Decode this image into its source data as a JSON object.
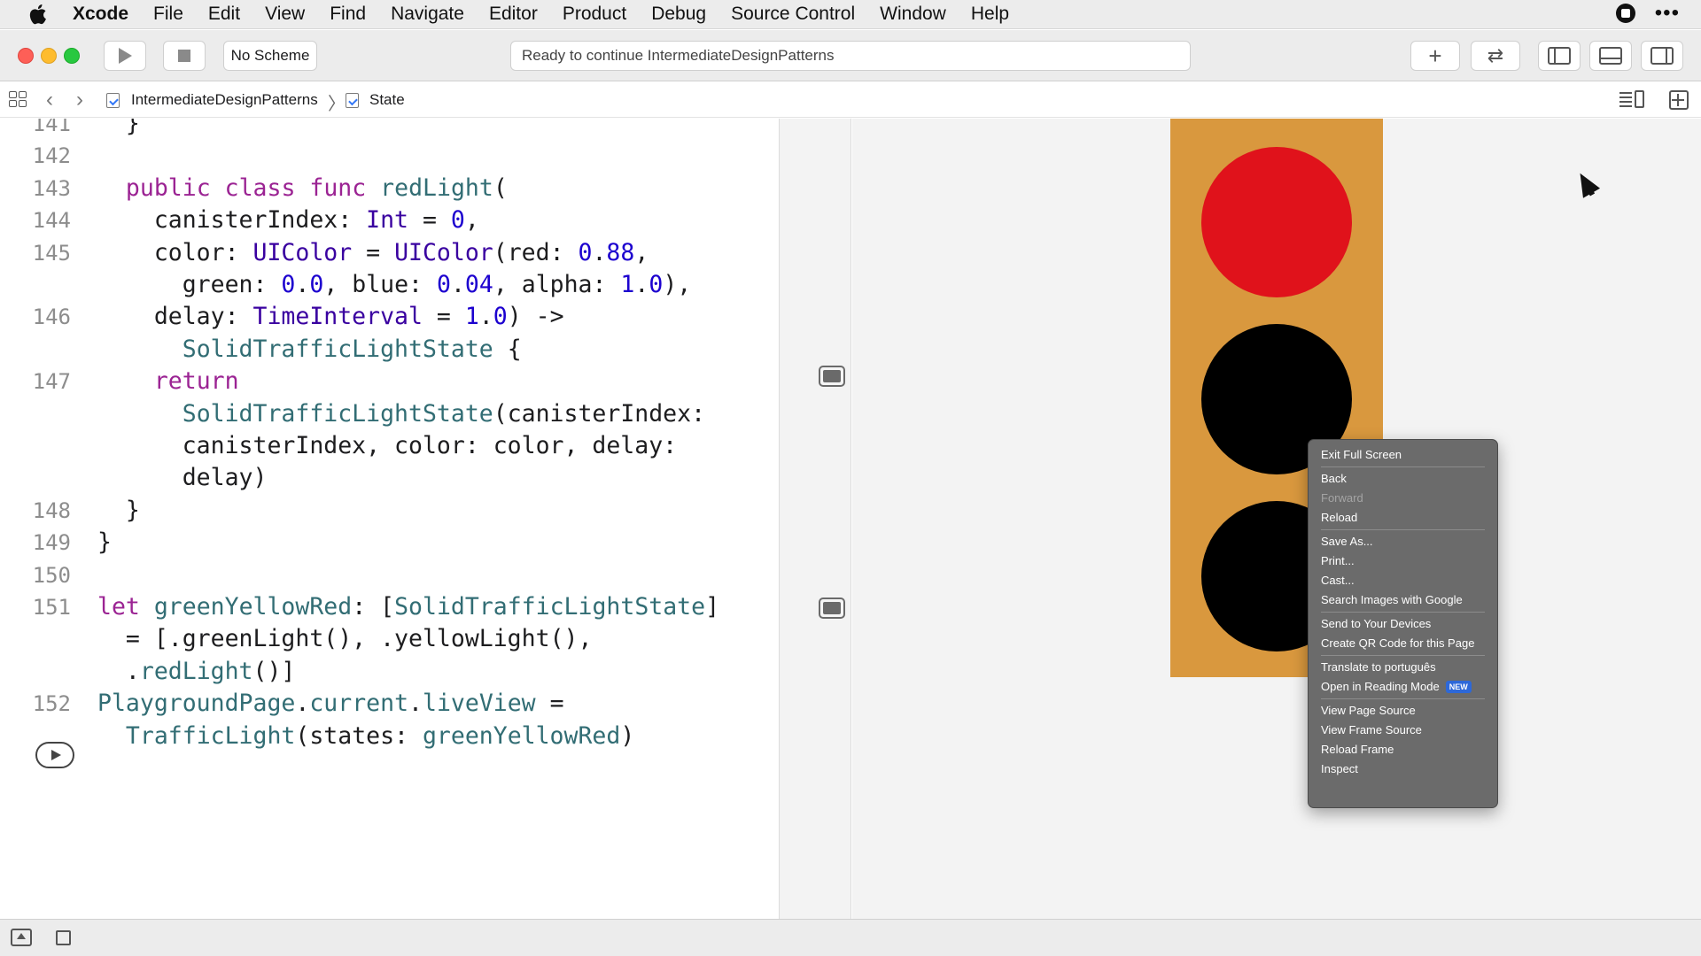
{
  "menubar": {
    "app_name": "Xcode",
    "items": [
      "File",
      "Edit",
      "View",
      "Find",
      "Navigate",
      "Editor",
      "Product",
      "Debug",
      "Source Control",
      "Window",
      "Help"
    ]
  },
  "toolbar": {
    "scheme_label": "No Scheme",
    "status_text": "Ready to continue IntermediateDesignPatterns",
    "add_label": "+",
    "swap_label": "⇄"
  },
  "jumpbar": {
    "crumbs": [
      "IntermediateDesignPatterns",
      "State"
    ],
    "separator": "〉",
    "back_label": "‹",
    "forward_label": "›"
  },
  "code": {
    "lines": [
      {
        "num": "141",
        "text": "  }"
      },
      {
        "num": "142",
        "text": ""
      },
      {
        "num": "143",
        "text": "  public class func redLight("
      },
      {
        "num": "144",
        "text": "    canisterIndex: Int = 0,"
      },
      {
        "num": "145",
        "text": "    color: UIColor = UIColor(red: 0.88,"
      },
      {
        "num": "",
        "text": "      green: 0.0, blue: 0.04, alpha: 1.0),"
      },
      {
        "num": "146",
        "text": "    delay: TimeInterval = 1.0) ->"
      },
      {
        "num": "",
        "text": "      SolidTrafficLightState {"
      },
      {
        "num": "147",
        "text": "    return"
      },
      {
        "num": "",
        "text": "      SolidTrafficLightState(canisterIndex:"
      },
      {
        "num": "",
        "text": "      canisterIndex, color: color, delay:"
      },
      {
        "num": "",
        "text": "      delay)"
      },
      {
        "num": "148",
        "text": "  }"
      },
      {
        "num": "149",
        "text": "}"
      },
      {
        "num": "150",
        "text": ""
      },
      {
        "num": "151",
        "text": "let greenYellowRed: [SolidTrafficLightState]"
      },
      {
        "num": "",
        "text": "  = [.greenLight(), .yellowLight(),"
      },
      {
        "num": "",
        "text": "  .redLight()]"
      },
      {
        "num": "152",
        "text": "PlaygroundPage.current.liveView ="
      },
      {
        "num": "",
        "text": "  TrafficLight(states: greenYellowRed)"
      }
    ]
  },
  "liveview": {
    "housing_color": "#d9983e",
    "lamps": [
      {
        "name": "red",
        "color": "#e0121b"
      },
      {
        "name": "yellow",
        "color": "#000000"
      },
      {
        "name": "green",
        "color": "#000000"
      }
    ]
  },
  "context_menu": {
    "groups": [
      [
        {
          "label": "Exit Full Screen",
          "enabled": true
        }
      ],
      [
        {
          "label": "Back",
          "enabled": true
        },
        {
          "label": "Forward",
          "enabled": false
        },
        {
          "label": "Reload",
          "enabled": true
        }
      ],
      [
        {
          "label": "Save As...",
          "enabled": true
        },
        {
          "label": "Print...",
          "enabled": true
        },
        {
          "label": "Cast...",
          "enabled": true
        },
        {
          "label": "Search Images with Google",
          "enabled": true
        }
      ],
      [
        {
          "label": "Send to Your Devices",
          "enabled": true
        },
        {
          "label": "Create QR Code for this Page",
          "enabled": true
        }
      ],
      [
        {
          "label": "Translate to português",
          "enabled": true
        },
        {
          "label": "Open in Reading Mode",
          "enabled": true,
          "badge": "NEW"
        }
      ],
      [
        {
          "label": "View Page Source",
          "enabled": true
        },
        {
          "label": "View Frame Source",
          "enabled": true
        },
        {
          "label": "Reload Frame",
          "enabled": true
        },
        {
          "label": "Inspect",
          "enabled": true
        }
      ]
    ]
  },
  "colors": {
    "keyword": "#9b2393",
    "type": "#3900a0",
    "number": "#1c00cf",
    "project": "#326d74"
  }
}
